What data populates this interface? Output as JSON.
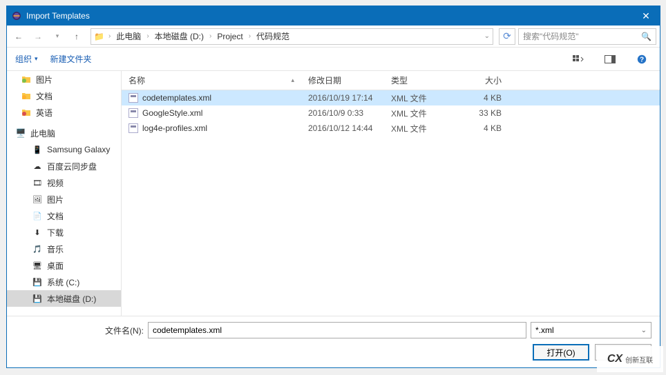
{
  "window": {
    "title": "Import Templates"
  },
  "breadcrumb": {
    "root": "此电脑",
    "parts": [
      "本地磁盘 (D:)",
      "Project",
      "代码规范"
    ]
  },
  "search": {
    "placeholder": "搜索\"代码规范\""
  },
  "toolbar": {
    "organize": "组织",
    "newfolder": "新建文件夹"
  },
  "sidebar": {
    "quick": [
      {
        "label": "图片",
        "color": "#7cc04c"
      },
      {
        "label": "文档",
        "color": "#ffb02e"
      },
      {
        "label": "英语",
        "color": "#d94f4f"
      }
    ],
    "computer_label": "此电脑",
    "computer": [
      {
        "label": "Samsung Galaxy",
        "ico": "📱"
      },
      {
        "label": "百度云同步盘",
        "ico": "☁"
      },
      {
        "label": "视频",
        "ico": "🎞"
      },
      {
        "label": "图片",
        "ico": "🖼"
      },
      {
        "label": "文档",
        "ico": "📄"
      },
      {
        "label": "下载",
        "ico": "⬇"
      },
      {
        "label": "音乐",
        "ico": "🎵"
      },
      {
        "label": "桌面",
        "ico": "🖥"
      },
      {
        "label": "系统 (C:)",
        "ico": "💾"
      },
      {
        "label": "本地磁盘 (D:)",
        "ico": "💾",
        "selected": true
      }
    ]
  },
  "columns": {
    "name": "名称",
    "date": "修改日期",
    "type": "类型",
    "size": "大小"
  },
  "files": [
    {
      "name": "codetemplates.xml",
      "date": "2016/10/19 17:14",
      "type": "XML 文件",
      "size": "4 KB",
      "selected": true
    },
    {
      "name": "GoogleStyle.xml",
      "date": "2016/10/9 0:33",
      "type": "XML 文件",
      "size": "33 KB",
      "selected": false
    },
    {
      "name": "log4e-profiles.xml",
      "date": "2016/10/12 14:44",
      "type": "XML 文件",
      "size": "4 KB",
      "selected": false
    }
  ],
  "footer": {
    "filename_label": "文件名(N):",
    "filename_value": "codetemplates.xml",
    "filter": "*.xml",
    "open": "打开(O)",
    "cancel": ""
  },
  "watermark": {
    "brand": "创新互联"
  }
}
